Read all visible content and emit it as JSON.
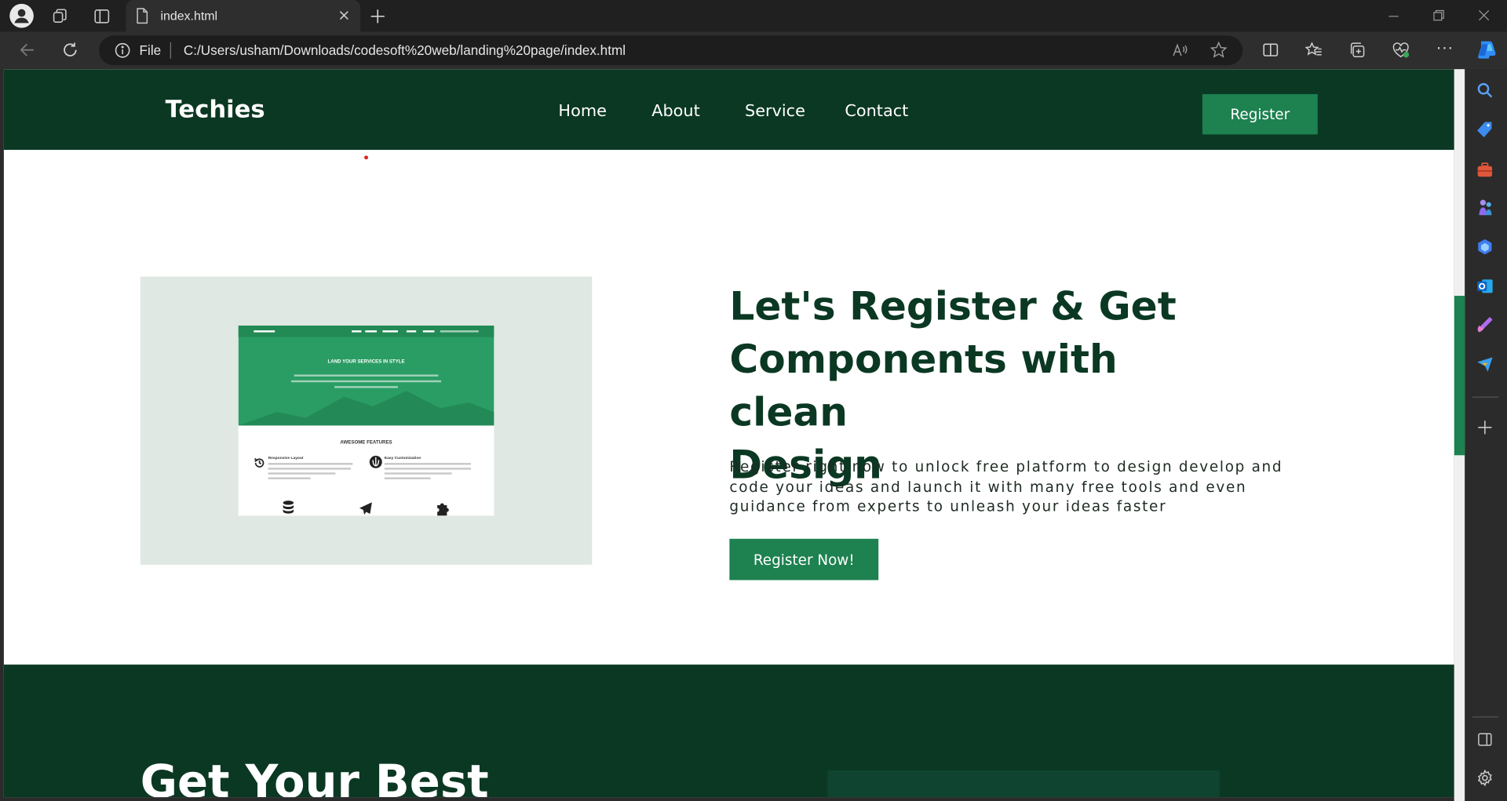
{
  "browser": {
    "tab_title": "index.html",
    "address_scheme": "File",
    "url": "C:/Users/usham/Downloads/codesoft%20web/landing%20page/index.html"
  },
  "site": {
    "logo": "Techies",
    "nav": [
      "Home",
      "About",
      "Service",
      "Contact"
    ],
    "register_button": "Register"
  },
  "hero": {
    "heading_lines": [
      "Let's Register & Get",
      "Components with clean",
      "Design"
    ],
    "paragraph": "Register right now to unlock free platform to design develop and code your ideas and launch it with many free tools and even guidance from experts to unleash your ideas faster",
    "cta": "Register Now!",
    "mockup": {
      "banner_title": "LAND YOUR SERVICES IN STYLE",
      "features_title": "AWESOME FEATURES",
      "feature_1": "Responsive Layout",
      "feature_2": "Easy Customization"
    }
  },
  "section2": {
    "title": "Get Your Best"
  },
  "colors": {
    "brand_dark": "#0b3823",
    "brand_button": "#1d8150",
    "hero_image_bg": "#dfe8e3"
  },
  "icons": [
    "profile-icon",
    "workspaces-icon",
    "tab-actions-icon",
    "file-icon",
    "close-icon",
    "new-tab-icon",
    "minimize-icon",
    "restore-icon",
    "window-close-icon",
    "back-icon",
    "refresh-icon",
    "info-icon",
    "read-aloud-icon",
    "favorite-star-icon",
    "split-screen-icon",
    "favorites-icon",
    "collections-icon",
    "browser-essentials-icon",
    "more-icon",
    "copilot-icon",
    "search-icon",
    "shopping-icon",
    "tools-icon",
    "games-icon",
    "bing-chat-icon",
    "outlook-icon",
    "designer-icon",
    "send-icon",
    "add-icon",
    "sidebar-toggle-icon",
    "settings-icon"
  ]
}
